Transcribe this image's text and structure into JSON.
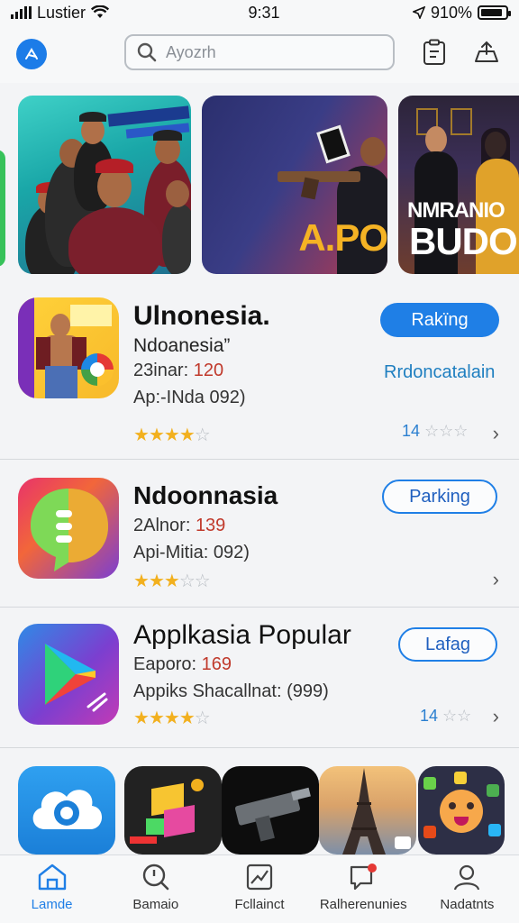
{
  "status_bar": {
    "carrier": "Lustier",
    "time": "9:31",
    "battery_text": "910%",
    "battery_level": 0.9
  },
  "header": {
    "search_placeholder": "Ayozrh"
  },
  "banners": [
    {
      "id": "banner-green"
    },
    {
      "id": "banner-team"
    },
    {
      "id": "banner-action",
      "text": "A.PO"
    },
    {
      "id": "banner-drama",
      "line1": "NMRANIO",
      "line2": "BUDORI"
    }
  ],
  "apps": [
    {
      "title": "Ulnonesia.",
      "subtitle": "Ndoanesia”",
      "meta_label": "23inar:",
      "meta_value": "120",
      "info": "Ap:-INda 092)",
      "rating": 4,
      "button": "Rakïng",
      "link": "Rrdoncatalain",
      "review_count": "14"
    },
    {
      "title": "Ndoonnasia",
      "meta_label": "2Alnor:",
      "meta_value": "139",
      "info": "Api-Mitia: 092)",
      "rating": 3,
      "button": "Parking"
    },
    {
      "title": "Applkasia Popular",
      "meta_label": "Eaporo:",
      "meta_value": "169",
      "info": "Appiks Shacallnat: (999)",
      "rating": 4,
      "button": "Lafag",
      "review_count": "14"
    }
  ],
  "tabs": [
    {
      "label": "Lamde",
      "icon": "home-icon",
      "active": true
    },
    {
      "label": "Bamaio",
      "icon": "search-icon",
      "active": false
    },
    {
      "label": "Fcllainct",
      "icon": "chart-icon",
      "active": false
    },
    {
      "label": "Ralherenunies",
      "icon": "chat-icon",
      "active": false
    },
    {
      "label": "Nadatnts",
      "icon": "profile-icon",
      "active": false
    }
  ],
  "colors": {
    "accent": "#1f7fe6",
    "star": "#f2b01e",
    "number_red": "#c0392b"
  }
}
